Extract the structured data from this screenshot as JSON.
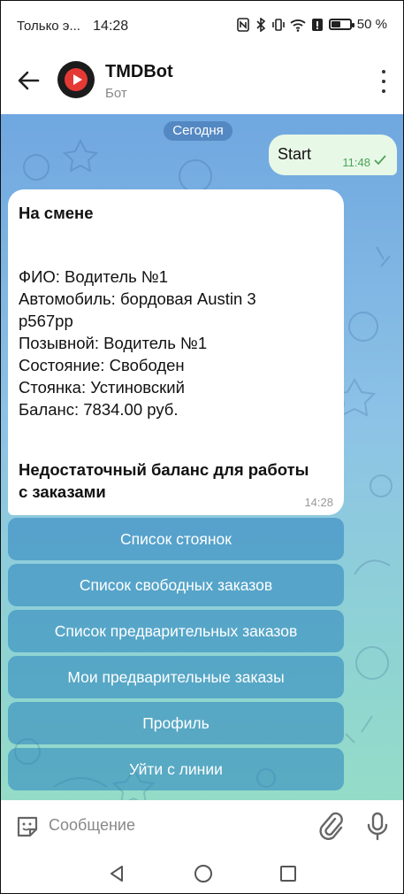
{
  "status_bar": {
    "notification": "Только э...",
    "time": "14:28",
    "battery": "50 %",
    "battery_level": 0.5
  },
  "header": {
    "title": "TMDBot",
    "subtitle": "Бот"
  },
  "chat": {
    "date_chip": "Сегодня",
    "outgoing": {
      "text": "Start",
      "time": "11:48"
    },
    "incoming": {
      "lines": [
        "На смене",
        "ФИО: Водитель №1",
        "Автомобиль: бордовая Austin 3",
        "р567рр",
        "Позывной: Водитель №1",
        "Состояние: Свободен",
        "Стоянка: Устиновский",
        "Баланс: 7834.00 руб.",
        "Недостаточный баланс для работы",
        "с заказами"
      ],
      "time": "14:28"
    },
    "keyboard": [
      "Список стоянок",
      "Список свободных заказов",
      "Список предварительных заказов",
      "Мои предварительные заказы",
      "Профиль",
      "Уйти с линии"
    ]
  },
  "input": {
    "placeholder": "Сообщение"
  }
}
